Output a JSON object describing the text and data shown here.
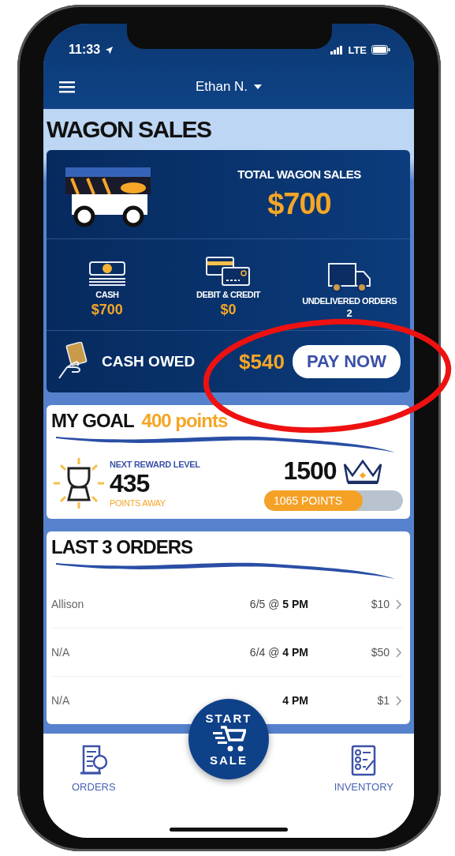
{
  "status_bar": {
    "time": "11:33",
    "network": "LTE"
  },
  "header": {
    "user": "Ethan N."
  },
  "title": "WAGON SALES",
  "sales": {
    "total_label": "TOTAL WAGON SALES",
    "total_value": "$700",
    "stats": [
      {
        "kind": "cash",
        "label": "CASH",
        "value": "$700"
      },
      {
        "kind": "card",
        "label": "DEBIT & CREDIT",
        "value": "$0"
      },
      {
        "kind": "truck",
        "label": "UNDELIVERED ORDERS",
        "value": "2"
      }
    ],
    "cash_owed": {
      "label": "CASH OWED",
      "amount": "$540",
      "button": "PAY NOW"
    }
  },
  "goal": {
    "title": "MY GOAL",
    "target": "400 points",
    "next_label": "NEXT REWARD LEVEL",
    "points_away": "435",
    "away_label": "POINTS AWAY",
    "level_target": "1500",
    "progress": {
      "label": "1065 POINTS",
      "level": 0.71
    }
  },
  "orders": {
    "title": "LAST 3 ORDERS",
    "rows": [
      {
        "name": "Allison",
        "date": "6/5 @ **5 PM**",
        "amount": "$10"
      },
      {
        "name": "N/A",
        "date": "6/4 @ **4 PM**",
        "amount": "$50"
      },
      {
        "name": "N/A",
        "date": "**4 PM**",
        "amount": "$1"
      }
    ]
  },
  "nav": {
    "items": [
      {
        "kind": "orders",
        "label": "ORDERS"
      },
      {
        "kind": "inventory",
        "label": "INVENTORY"
      }
    ],
    "start_sale": {
      "top": "START",
      "bottom": "SALE"
    }
  },
  "annotation": {
    "kind": "ellipse"
  }
}
